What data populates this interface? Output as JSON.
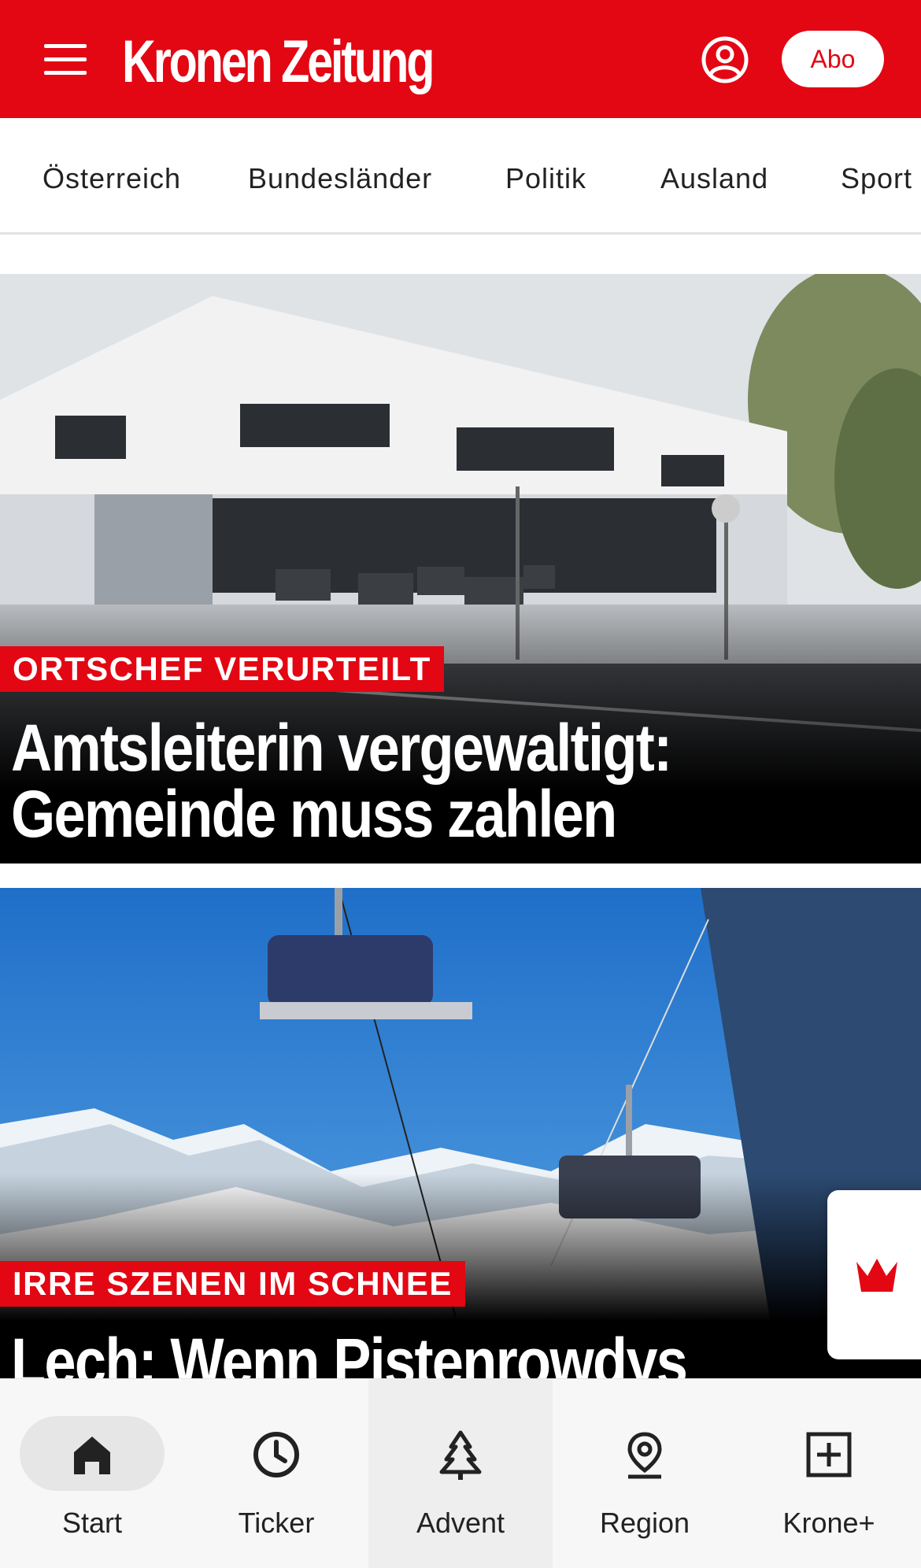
{
  "header": {
    "logo": "Kronen Zeitung",
    "abo_label": "Abo",
    "brand_color": "#e30613"
  },
  "categories": [
    {
      "label": "Österreich"
    },
    {
      "label": "Bundesländer"
    },
    {
      "label": "Politik"
    },
    {
      "label": "Ausland"
    },
    {
      "label": "Sport"
    }
  ],
  "articles": [
    {
      "kicker": "ORTSCHEF VERURTEILT",
      "headline_line1": "Amtsleiterin vergewaltigt:",
      "headline_line2": "Gemeinde muss zahlen",
      "image": "photo of a white modern municipal office building (Gemeindeamt) with planters on the street"
    },
    {
      "kicker": "IRRE SZENEN IM SCHNEE",
      "headline_line1": "Lech: Wenn Pistenrowdys",
      "image": "photo of chairlifts against blue sky with snowy mountains"
    }
  ],
  "widget": {
    "icon": "crown-icon"
  },
  "bottom_nav": [
    {
      "label": "Start",
      "icon": "home-icon",
      "active": true
    },
    {
      "label": "Ticker",
      "icon": "clock-icon"
    },
    {
      "label": "Advent",
      "icon": "tree-icon"
    },
    {
      "label": "Region",
      "icon": "location-pin-icon"
    },
    {
      "label": "Krone+",
      "icon": "plus-box-icon"
    }
  ]
}
